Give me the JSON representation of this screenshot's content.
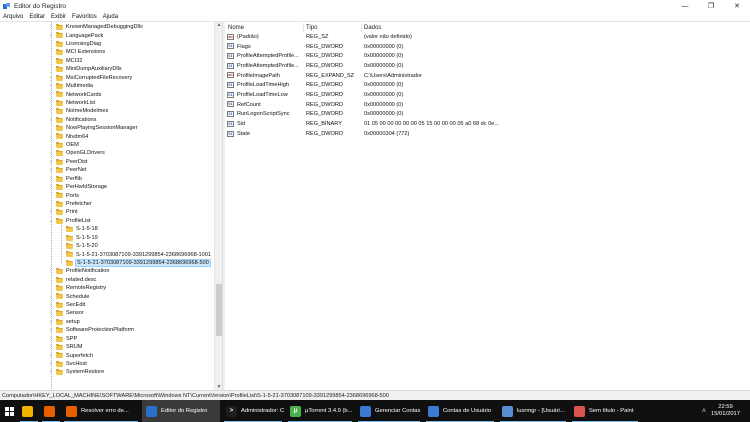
{
  "window": {
    "title": "Editor do Registro",
    "min_glyph": "—",
    "max_glyph": "❐",
    "close_glyph": "✕",
    "icon": "regedit-icon"
  },
  "menu": [
    "Arquivo",
    "Editar",
    "Exibir",
    "Favoritos",
    "Ajuda"
  ],
  "tree": {
    "items": [
      {
        "label": "KnownManagedDebuggingDlls",
        "level": 0,
        "expander": "›"
      },
      {
        "label": "LanguagePack",
        "level": 0,
        "expander": "›"
      },
      {
        "label": "LicensingDiag",
        "level": 0,
        "expander": ""
      },
      {
        "label": "MCI Extensions",
        "level": 0,
        "expander": ""
      },
      {
        "label": "MCI32",
        "level": 0,
        "expander": ""
      },
      {
        "label": "MiniDumpAuxiliaryDlls",
        "level": 0,
        "expander": ""
      },
      {
        "label": "MsiCorruptedFileRecovery",
        "level": 0,
        "expander": "›"
      },
      {
        "label": "Multimedia",
        "level": 0,
        "expander": "›"
      },
      {
        "label": "NetworkCards",
        "level": 0,
        "expander": "›"
      },
      {
        "label": "NetworkList",
        "level": 0,
        "expander": "›"
      },
      {
        "label": "NoImeModelmes",
        "level": 0,
        "expander": "›"
      },
      {
        "label": "Notifications",
        "level": 0,
        "expander": "›"
      },
      {
        "label": "NowPlayingSessionManager",
        "level": 0,
        "expander": ""
      },
      {
        "label": "Ntvdm64",
        "level": 0,
        "expander": "›"
      },
      {
        "label": "OEM",
        "level": 0,
        "expander": ""
      },
      {
        "label": "OpenGLDrivers",
        "level": 0,
        "expander": "›"
      },
      {
        "label": "PeerDist",
        "level": 0,
        "expander": "›"
      },
      {
        "label": "PeerNet",
        "level": 0,
        "expander": "›"
      },
      {
        "label": "Perflib",
        "level": 0,
        "expander": "›"
      },
      {
        "label": "PerHwIdStorage",
        "level": 0,
        "expander": "›"
      },
      {
        "label": "Ports",
        "level": 0,
        "expander": ""
      },
      {
        "label": "Prefetcher",
        "level": 0,
        "expander": ""
      },
      {
        "label": "Print",
        "level": 0,
        "expander": "›"
      },
      {
        "label": "ProfileList",
        "level": 0,
        "expander": "⌄"
      },
      {
        "label": "S-1-5-18",
        "level": 1,
        "expander": ""
      },
      {
        "label": "S-1-5-19",
        "level": 1,
        "expander": ""
      },
      {
        "label": "S-1-5-20",
        "level": 1,
        "expander": ""
      },
      {
        "label": "S-1-5-21-3703087109-3391299854-2368696968-1001",
        "level": 1,
        "expander": ""
      },
      {
        "label": "S-1-5-21-3703087109-3391299854-2368696968-500",
        "level": 1,
        "expander": "",
        "selected": true
      },
      {
        "label": "ProfileNotification",
        "level": 0,
        "expander": "›"
      },
      {
        "label": "related.desc",
        "level": 0,
        "expander": ""
      },
      {
        "label": "RemoteRegistry",
        "level": 0,
        "expander": ""
      },
      {
        "label": "Schedule",
        "level": 0,
        "expander": "›"
      },
      {
        "label": "SecEdit",
        "level": 0,
        "expander": "›"
      },
      {
        "label": "Sensor",
        "level": 0,
        "expander": "›"
      },
      {
        "label": "setup",
        "level": 0,
        "expander": "›"
      },
      {
        "label": "SoftwareProtectionPlatform",
        "level": 0,
        "expander": "›"
      },
      {
        "label": "SPP",
        "level": 0,
        "expander": "›"
      },
      {
        "label": "SRUM",
        "level": 0,
        "expander": "›"
      },
      {
        "label": "Superfetch",
        "level": 0,
        "expander": "›"
      },
      {
        "label": "SvcHost",
        "level": 0,
        "expander": "›"
      },
      {
        "label": "SystemRestore",
        "level": 0,
        "expander": "›"
      }
    ]
  },
  "values": {
    "columns": [
      "Nome",
      "Tipo",
      "Dados"
    ],
    "rows": [
      {
        "name": "(Padrão)",
        "type": "REG_SZ",
        "data": "(valor não definido)",
        "icon": "ab"
      },
      {
        "name": "Flags",
        "type": "REG_DWORD",
        "data": "0x00000000 (0)",
        "icon": "bin"
      },
      {
        "name": "ProfileAttemptedProfile...",
        "type": "REG_DWORD",
        "data": "0x00000000 (0)",
        "icon": "bin"
      },
      {
        "name": "ProfileAttemptedProfile...",
        "type": "REG_DWORD",
        "data": "0x00000000 (0)",
        "icon": "bin"
      },
      {
        "name": "ProfileImagePath",
        "type": "REG_EXPAND_SZ",
        "data": "C:\\Users\\Administrador",
        "icon": "ab"
      },
      {
        "name": "ProfileLoadTimeHigh",
        "type": "REG_DWORD",
        "data": "0x00000000 (0)",
        "icon": "bin"
      },
      {
        "name": "ProfileLoadTimeLow",
        "type": "REG_DWORD",
        "data": "0x00000000 (0)",
        "icon": "bin"
      },
      {
        "name": "RefCount",
        "type": "REG_DWORD",
        "data": "0x00000000 (0)",
        "icon": "bin"
      },
      {
        "name": "RunLogonScriptSync",
        "type": "REG_DWORD",
        "data": "0x00000000 (0)",
        "icon": "bin"
      },
      {
        "name": "Sid",
        "type": "REG_BINARY",
        "data": "01 05 00 00 00 00 00 05 15 00 00 00 05 a0 68 dc 0e...",
        "icon": "bin"
      },
      {
        "name": "State",
        "type": "REG_DWORD",
        "data": "0x00000304 (772)",
        "icon": "bin"
      }
    ]
  },
  "status_path": "Computador\\HKEY_LOCAL_MACHINE\\SOFTWARE\\Microsoft\\Windows NT\\CurrentVersion\\ProfileList\\S-1-5-21-3703087109-3391299854-2368696968-500",
  "taskbar": {
    "items": [
      {
        "label": "",
        "icon": "file-explorer-icon",
        "color": "#f0b400",
        "glyph": "",
        "state": "open"
      },
      {
        "label": "",
        "icon": "firefox-icon",
        "color": "#e66000",
        "glyph": "",
        "state": "open"
      },
      {
        "label": "Resolver erro de...",
        "icon": "firefox-icon",
        "color": "#e66000",
        "glyph": "",
        "state": "open"
      },
      {
        "label": "Editor do Registro",
        "icon": "regedit-icon",
        "color": "#2a6fc9",
        "glyph": "",
        "state": "active"
      },
      {
        "label": "Administrador: C...",
        "icon": "cmd-icon",
        "color": "#1e1e1e",
        "glyph": ">",
        "state": "open"
      },
      {
        "label": "µTorrent 3.4.9  (b...",
        "icon": "utorrent-icon",
        "color": "#4caf50",
        "glyph": "µ",
        "state": "open"
      },
      {
        "label": "Gerenciar Contas",
        "icon": "users-icon",
        "color": "#3b7bd4",
        "glyph": "",
        "state": "open"
      },
      {
        "label": "Contas de Usuário",
        "icon": "users-icon",
        "color": "#3b7bd4",
        "glyph": "",
        "state": "open"
      },
      {
        "label": "lusrmgr - [Usuári...",
        "icon": "mmc-icon",
        "color": "#5a8fd6",
        "glyph": "",
        "state": "open"
      },
      {
        "label": "Sem título - Paint",
        "icon": "paint-icon",
        "color": "#d9534f",
        "glyph": "",
        "state": "open"
      }
    ],
    "clock_time": "22:59",
    "clock_date": "15/01/2017",
    "tray_up": "˄"
  }
}
